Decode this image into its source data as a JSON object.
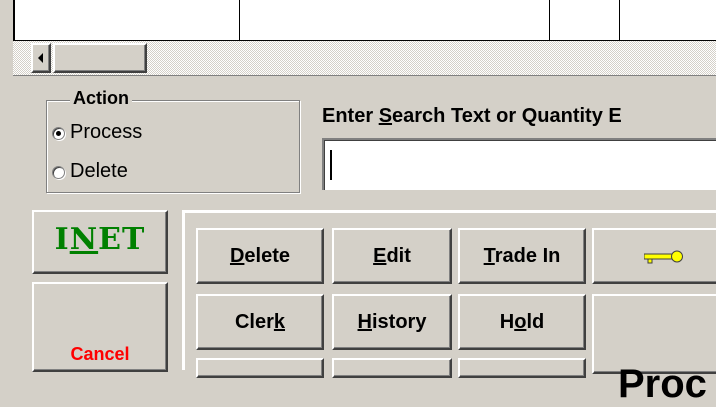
{
  "grid": {
    "columns": 5
  },
  "action_group": {
    "title": "Action",
    "options": [
      {
        "label": "Process",
        "selected": true
      },
      {
        "label": "Delete",
        "selected": false
      }
    ]
  },
  "search": {
    "label_pre": "Enter ",
    "label_accel": "S",
    "label_post": "earch Text or Quantity E",
    "value": ""
  },
  "left_buttons": {
    "inet_pre": "I",
    "inet_accel": "N",
    "inet_post": "ET",
    "cancel": "Cancel"
  },
  "function_buttons": {
    "delete": {
      "accel": "D",
      "rest": "elete"
    },
    "edit": {
      "accel": "E",
      "rest": "dit"
    },
    "trade_in": {
      "accel": "T",
      "rest": "rade In"
    },
    "clerk": {
      "pre": "Cler",
      "accel": "k"
    },
    "history": {
      "accel": "H",
      "rest": "istory"
    },
    "hold": {
      "pre": "H",
      "accel": "o",
      "rest": "ld"
    },
    "process": "Proc"
  },
  "colors": {
    "face": "#d4d0c8",
    "inet": "#008000",
    "cancel": "#ff0000",
    "key": "#ffff00"
  },
  "icons": {
    "key": "key-icon",
    "scroll_left": "arrow-left-icon"
  }
}
